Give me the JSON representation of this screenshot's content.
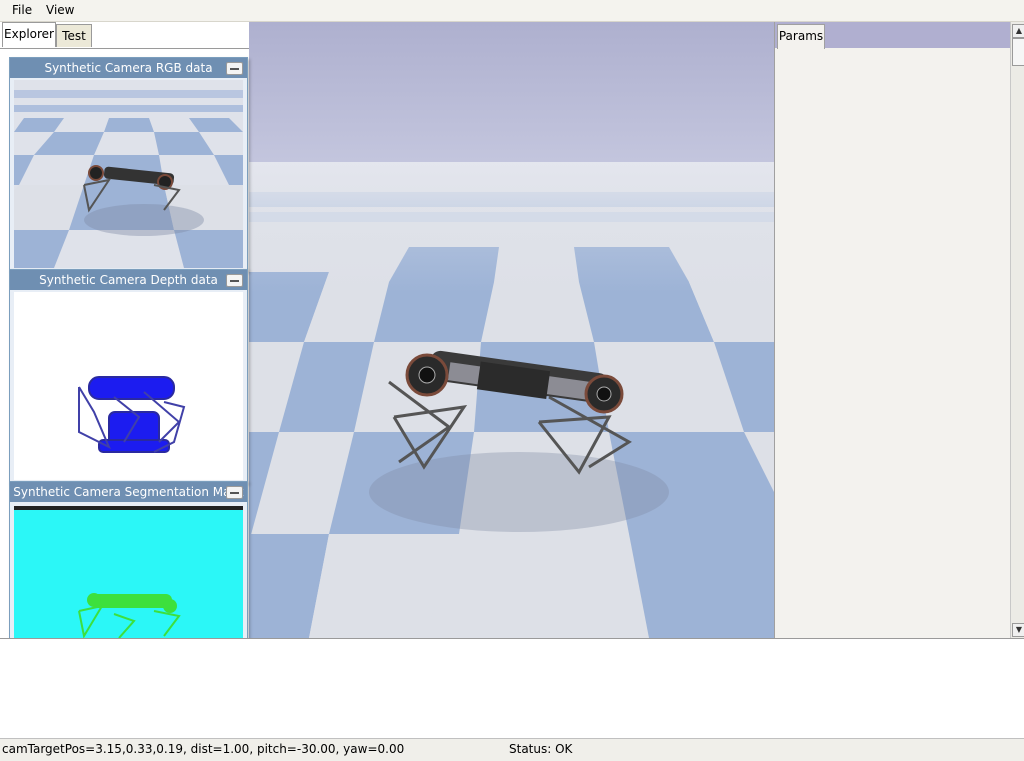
{
  "menubar": {
    "file_label": "File",
    "view_label": "View"
  },
  "left_panel": {
    "tabs": [
      {
        "label": "Explorer"
      },
      {
        "label": "Test"
      }
    ]
  },
  "camera_windows": [
    {
      "title": "Synthetic Camera RGB data"
    },
    {
      "title": "Synthetic Camera Depth data"
    },
    {
      "title": "Synthetic Camera Segmentation Mask"
    }
  ],
  "right_panel": {
    "tab_label": "Params"
  },
  "status_bar": {
    "camera_info": "camTargetPos=3.15,0.33,0.19, dist=1.00, pitch=-30.00, yaw=0.00",
    "status": "Status: OK"
  },
  "colors": {
    "sky": "#b3b3d0",
    "tile_light": "#dfe2e8",
    "tile_blue": "#9db3d6",
    "depth_mask": "#1c1cf0",
    "segmentation_bg": "#2bf7f7",
    "segmentation_robot": "#3de03d",
    "title_bar": "#6f8fb2"
  }
}
